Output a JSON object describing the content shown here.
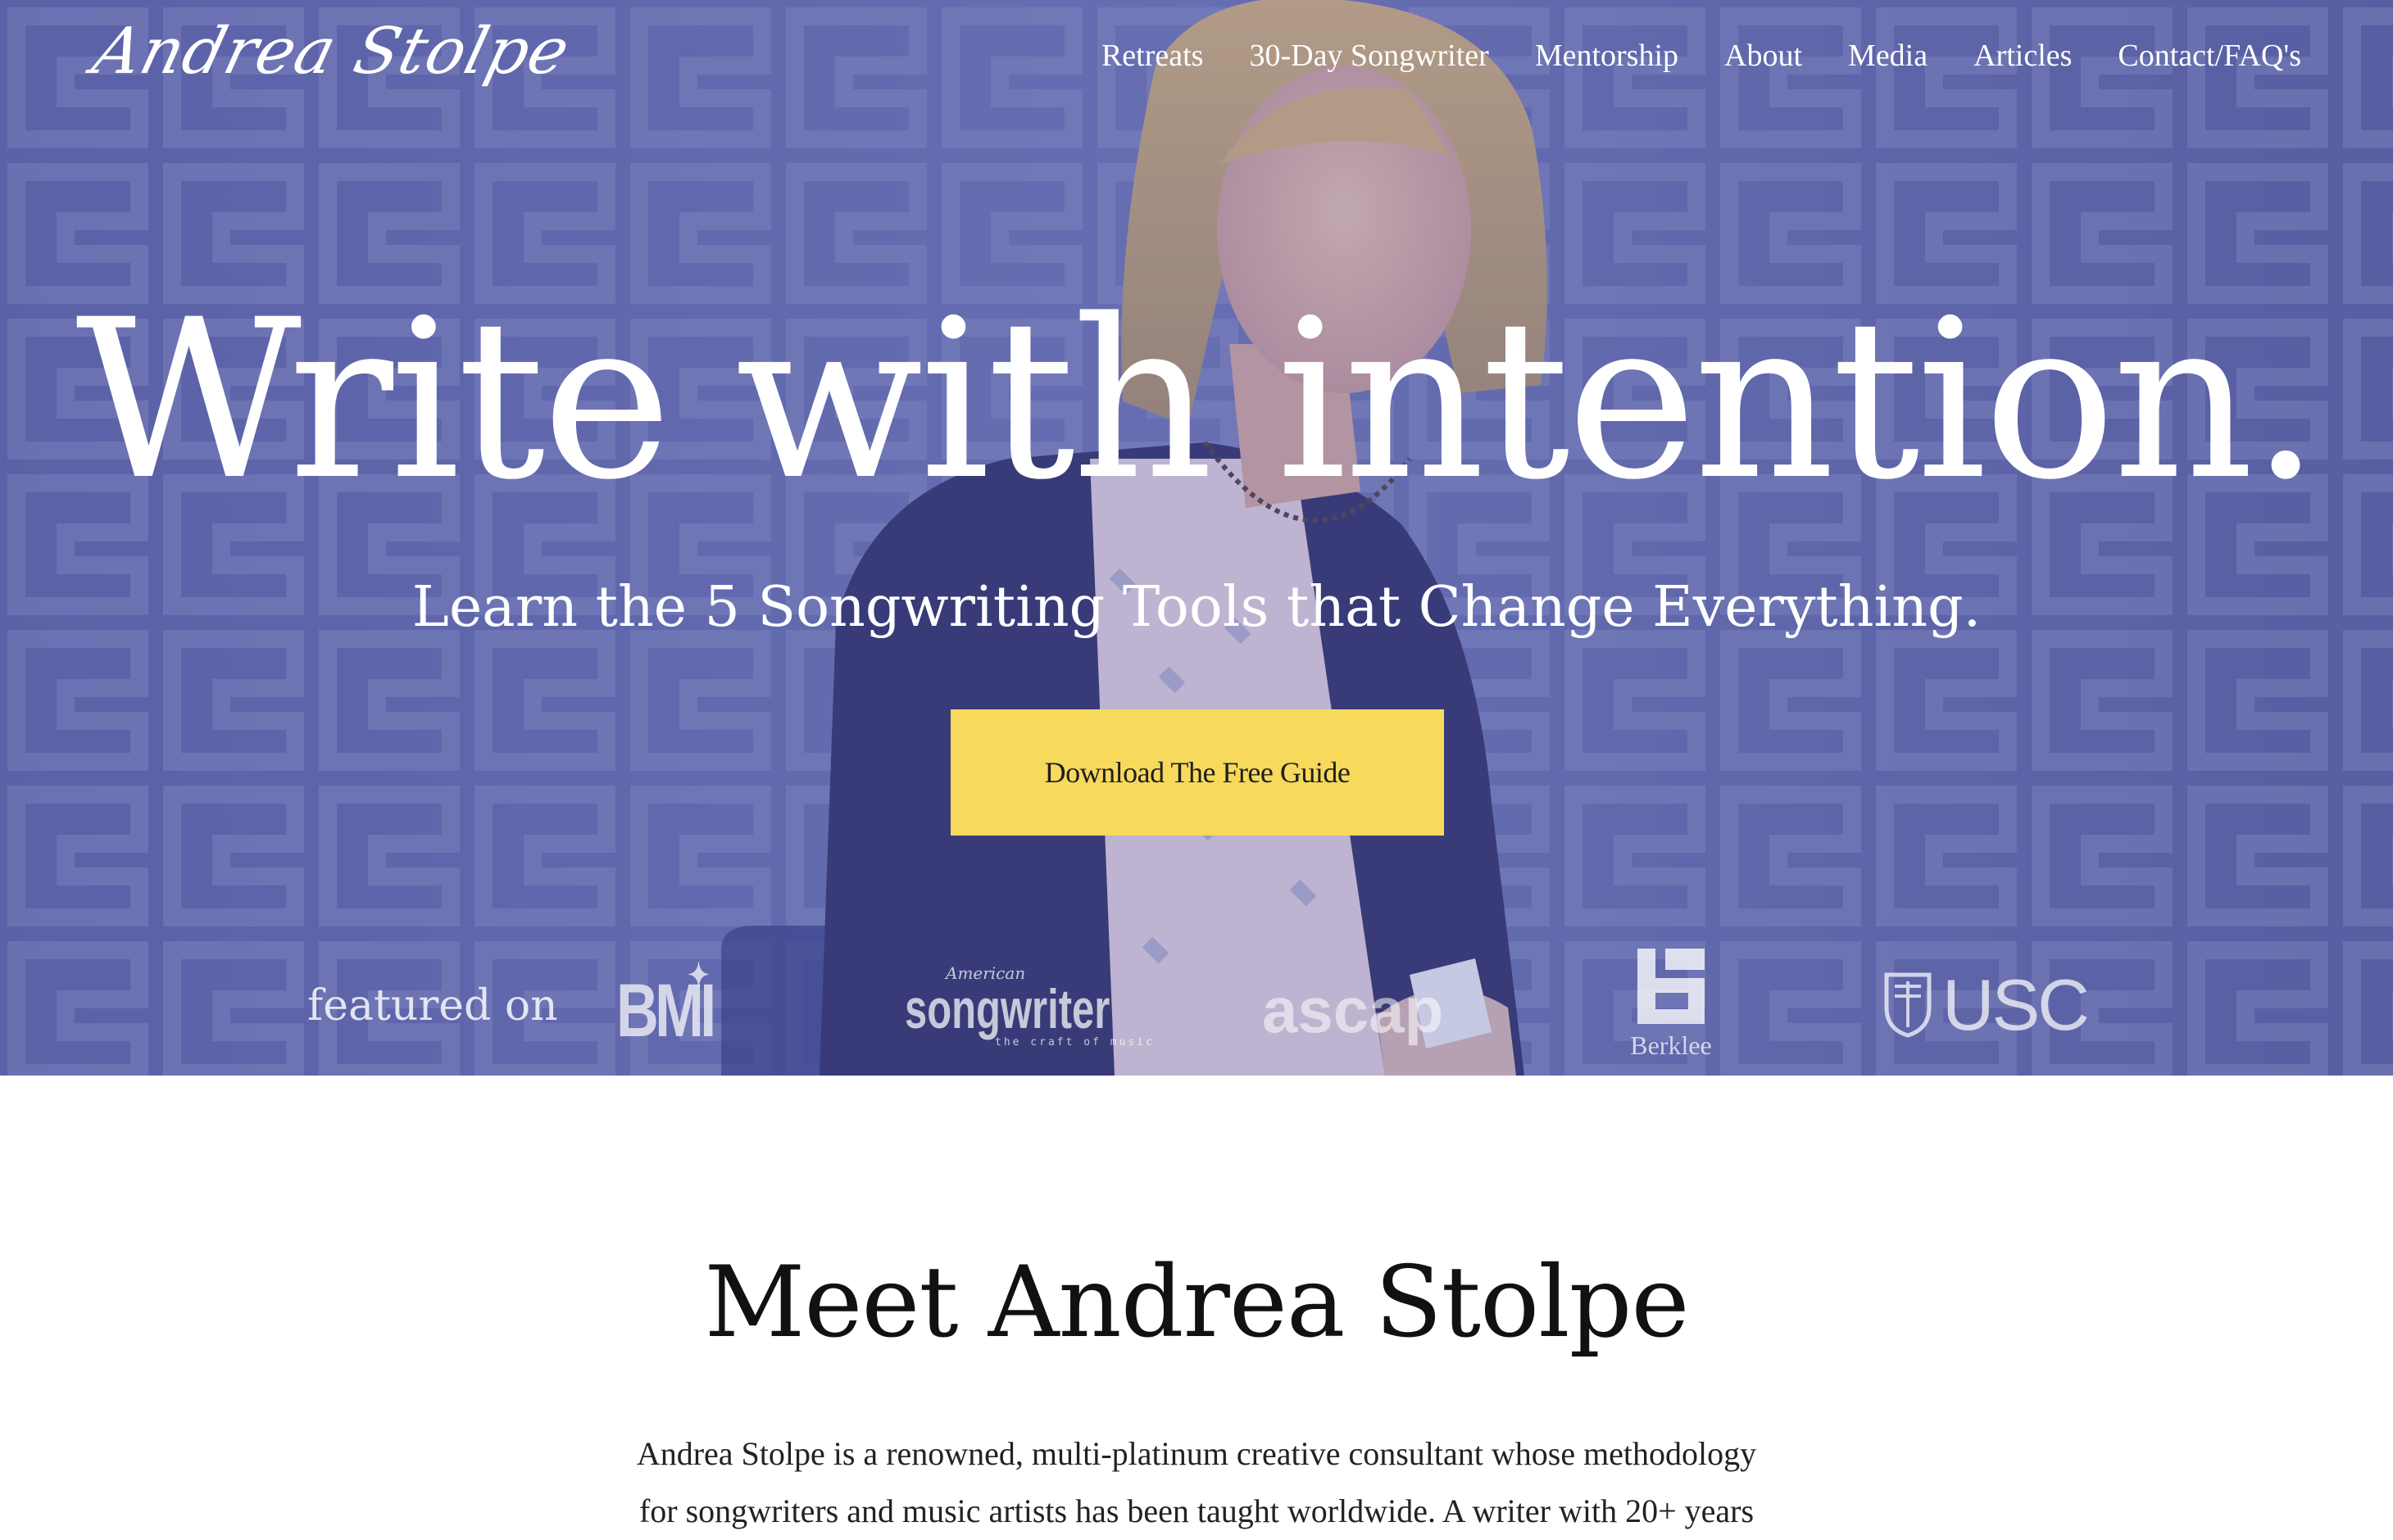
{
  "header": {
    "logo_text": "Andrea Stolpe",
    "nav": [
      {
        "label": "Retreats"
      },
      {
        "label": "30-Day Songwriter"
      },
      {
        "label": "Mentorship"
      },
      {
        "label": "About"
      },
      {
        "label": "Media"
      },
      {
        "label": "Articles"
      },
      {
        "label": "Contact/FAQ's"
      }
    ]
  },
  "hero": {
    "headline": "Write with intention.",
    "subheadline": "Learn the 5 Songwriting Tools that Change Everything.",
    "cta_label": "Download The Free Guide",
    "cta_color": "#f7d95c",
    "overlay_color": "#5d63a8"
  },
  "featured": {
    "label": "featured on",
    "logos": {
      "bmi": "BMI",
      "songwriter_small": "American",
      "songwriter_big": "songwriter",
      "songwriter_tag": "the craft of music",
      "ascap": "ascap",
      "berklee": "Berklee",
      "usc": "USC"
    }
  },
  "about": {
    "title": "Meet Andrea Stolpe",
    "body": "Andrea Stolpe is a renowned, multi-platinum creative consultant whose methodology for songwriters and music artists has been taught worldwide. A writer with 20+ years"
  }
}
